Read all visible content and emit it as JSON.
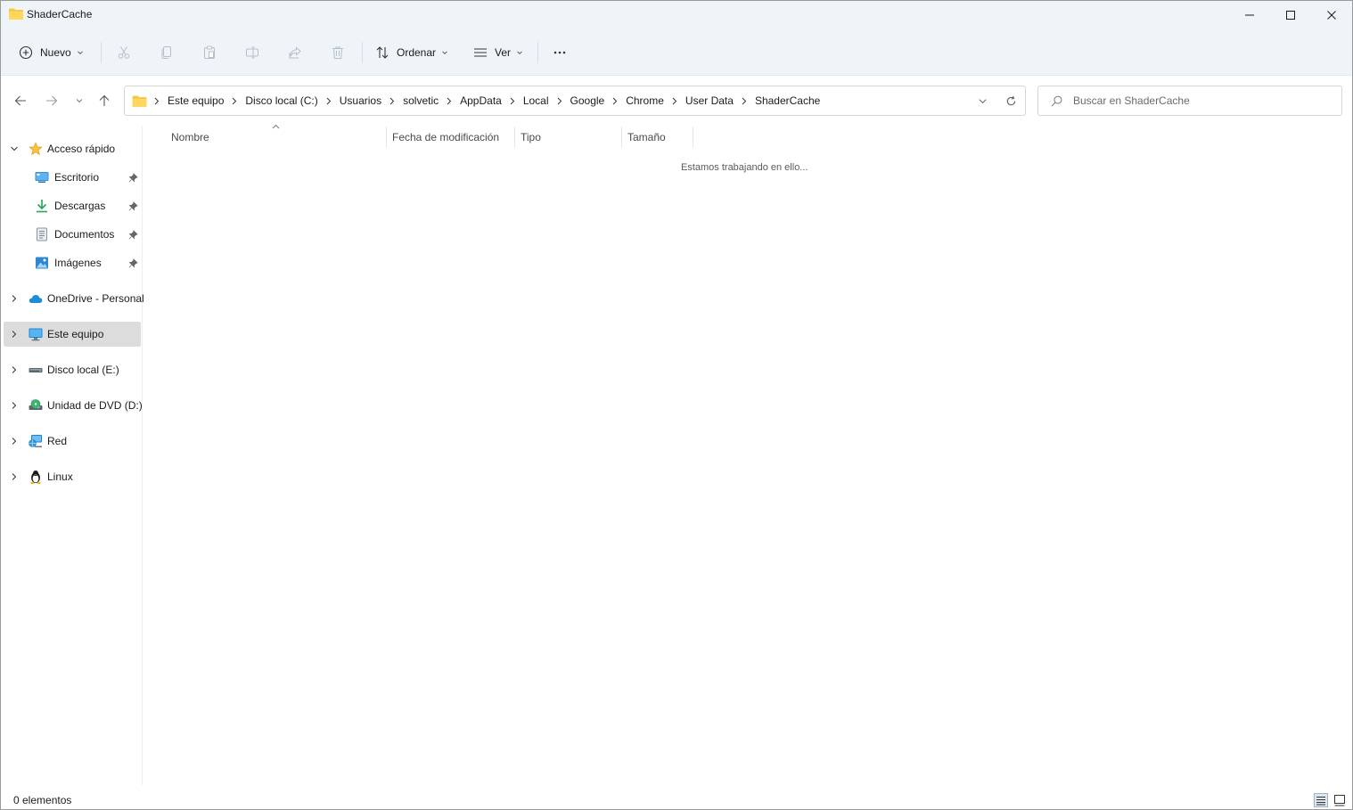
{
  "window": {
    "title": "ShaderCache",
    "minimize_icon": "minimize-icon",
    "maximize_icon": "maximize-icon",
    "close_icon": "close-icon"
  },
  "toolbar": {
    "new_label": "Nuevo",
    "sort_label": "Ordenar",
    "view_label": "Ver",
    "icons": [
      "plus-circle-icon",
      "cut-icon",
      "copy-icon",
      "paste-icon",
      "rename-icon",
      "share-icon",
      "delete-icon",
      "sort-icon",
      "view-icon",
      "more-icon"
    ]
  },
  "address": {
    "crumbs": [
      "Este equipo",
      "Disco local (C:)",
      "Usuarios",
      "solvetic",
      "AppData",
      "Local",
      "Google",
      "Chrome",
      "User Data",
      "ShaderCache"
    ]
  },
  "search": {
    "placeholder": "Buscar en ShaderCache"
  },
  "sidebar": {
    "items": [
      {
        "label": "Acceso rápido",
        "icon": "star-icon",
        "expanded": true
      },
      {
        "label": "Escritorio",
        "icon": "desktop-icon",
        "pinned": true
      },
      {
        "label": "Descargas",
        "icon": "download-icon",
        "pinned": true
      },
      {
        "label": "Documentos",
        "icon": "document-icon",
        "pinned": true
      },
      {
        "label": "Imágenes",
        "icon": "pictures-icon",
        "pinned": true
      },
      {
        "label": "OneDrive - Personal",
        "icon": "cloud-icon"
      },
      {
        "label": "Este equipo",
        "icon": "computer-icon",
        "selected": true
      },
      {
        "label": "Disco local (E:)",
        "icon": "drive-icon"
      },
      {
        "label": "Unidad de DVD (D:)",
        "icon": "dvd-icon"
      },
      {
        "label": "Red",
        "icon": "network-icon"
      },
      {
        "label": "Linux",
        "icon": "linux-icon"
      }
    ]
  },
  "columns": {
    "name": "Nombre",
    "modified": "Fecha de modificación",
    "type": "Tipo",
    "size": "Tamaño"
  },
  "content": {
    "empty_message": "Estamos trabajando en ello..."
  },
  "status": {
    "item_count": "0 elementos"
  },
  "colors": {
    "chrome_bg": "#eff4f9",
    "folder_yellow": "#f7c948",
    "selected_bg": "#dcdcdc",
    "accent_blue": "#1d8dd8"
  }
}
